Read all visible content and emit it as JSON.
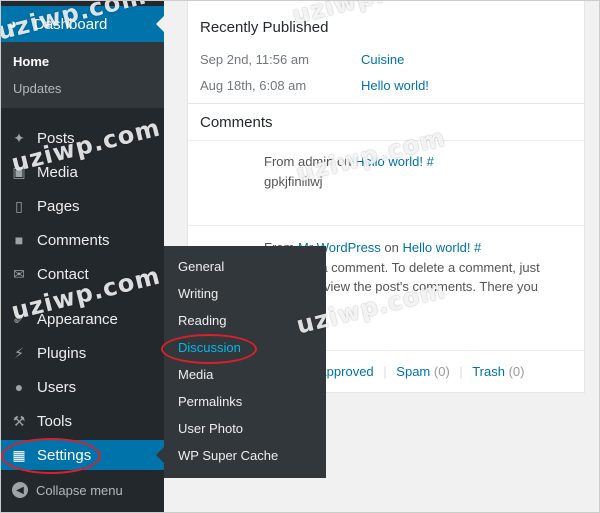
{
  "sidebar": {
    "dashboard": {
      "label": "Dashboard",
      "icon": "dashboard-icon"
    },
    "submenu": {
      "home": "Home",
      "updates": "Updates"
    },
    "items": [
      {
        "label": "Posts",
        "icon": "pin-icon"
      },
      {
        "label": "Media",
        "icon": "media-icon"
      },
      {
        "label": "Pages",
        "icon": "pages-icon"
      },
      {
        "label": "Comments",
        "icon": "comment-icon"
      },
      {
        "label": "Contact",
        "icon": "mail-icon"
      },
      {
        "label": "Appearance",
        "icon": "brush-icon"
      },
      {
        "label": "Plugins",
        "icon": "plug-icon"
      },
      {
        "label": "Users",
        "icon": "user-icon"
      },
      {
        "label": "Tools",
        "icon": "wrench-icon"
      },
      {
        "label": "Settings",
        "icon": "settings-icon",
        "active": true
      }
    ],
    "collapse": "Collapse menu"
  },
  "settings_flyout": {
    "items": [
      "General",
      "Writing",
      "Reading",
      "Discussion",
      "Media",
      "Permalinks",
      "User Photo",
      "WP Super Cache"
    ],
    "current": "Discussion"
  },
  "recently_published": {
    "title": "Recently Published",
    "posts": [
      {
        "date": "Sep 2nd, 11:56 am",
        "title": "Cuisine"
      },
      {
        "date": "Aug 18th, 6:08 am",
        "title": "Hello world!"
      }
    ]
  },
  "comments": {
    "title": "Comments",
    "items": [
      {
        "from_prefix": "From",
        "author": "admin",
        "on": "on",
        "post": "Hello world! #",
        "excerpt": "gpkjfinlliwj"
      },
      {
        "from_prefix": "From",
        "author": "Mr WordPress",
        "on": "on",
        "post": "Hello world! #",
        "excerpt_line1": "Hi, this is a comment. To delete a comment, just",
        "excerpt_line2": "log in and view the post's comments. There you"
      }
    ],
    "footer": {
      "approved": "Approved",
      "spam": "Spam",
      "spam_count": "(0)",
      "trash": "Trash",
      "trash_count": "(0)"
    }
  },
  "watermark": "uziwp.com",
  "colors": {
    "sidebar_bg": "#23282d",
    "accent": "#0073aa",
    "current_submenu": "#00b9eb",
    "highlight_ring": "#d9202b"
  }
}
